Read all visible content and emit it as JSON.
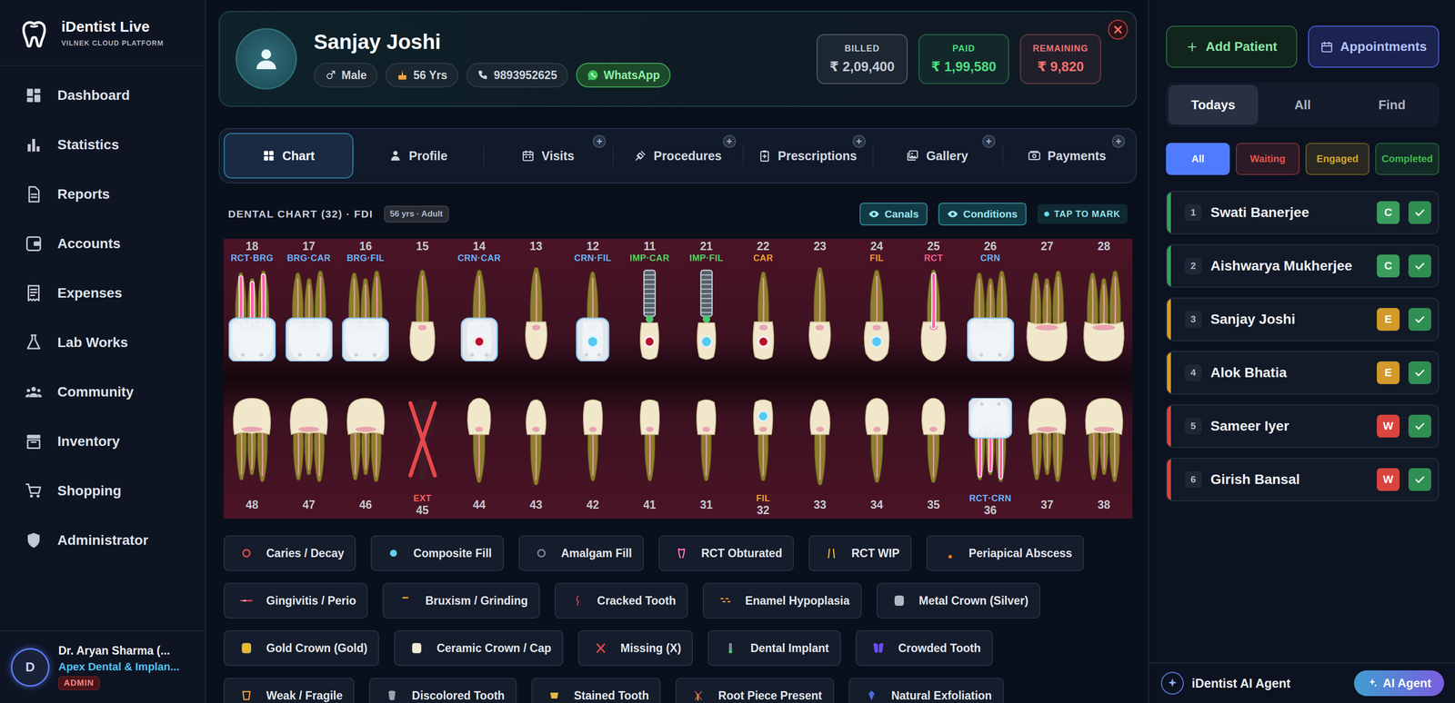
{
  "app": {
    "name": "iDentist Live",
    "subtitle": "VILNEK CLOUD PLATFORM"
  },
  "sidebar": {
    "items": [
      {
        "label": "Dashboard"
      },
      {
        "label": "Statistics"
      },
      {
        "label": "Reports"
      },
      {
        "label": "Accounts"
      },
      {
        "label": "Expenses"
      },
      {
        "label": "Lab Works"
      },
      {
        "label": "Community"
      },
      {
        "label": "Inventory"
      },
      {
        "label": "Shopping"
      },
      {
        "label": "Administrator"
      }
    ]
  },
  "user": {
    "avatar": "D",
    "name": "Dr. Aryan Sharma (...",
    "clinic": "Apex Dental & Implan...",
    "role": "ADMIN"
  },
  "patient": {
    "name": "Sanjay Joshi",
    "gender": "Male",
    "age": "56 Yrs",
    "phone": "9893952625",
    "whatsapp": "WhatsApp"
  },
  "billing": [
    {
      "label": "BILLED",
      "value": "₹ 2,09,400",
      "color": "#c3cad4"
    },
    {
      "label": "PAID",
      "value": "₹ 1,99,580",
      "color": "#4ade80"
    },
    {
      "label": "REMAINING",
      "value": "₹ 9,820",
      "color": "#f87171"
    }
  ],
  "tabs": [
    {
      "label": "Chart",
      "selected": true
    },
    {
      "label": "Profile",
      "selected": false
    },
    {
      "label": "Visits",
      "selected": false,
      "badge": "+"
    },
    {
      "label": "Procedures",
      "selected": false,
      "badge": "+"
    },
    {
      "label": "Prescriptions",
      "selected": false,
      "badge": "+"
    },
    {
      "label": "Gallery",
      "selected": false,
      "badge": "+"
    },
    {
      "label": "Payments",
      "selected": false,
      "badge": "+"
    }
  ],
  "chart": {
    "title": "DENTAL CHART (32) · FDI",
    "badge": "56 yrs · Adult",
    "toggles": [
      {
        "label": "Canals",
        "on": true
      },
      {
        "label": "Conditions",
        "on": true
      }
    ],
    "tap": "TAP TO MARK",
    "upper": [
      {
        "number": "18",
        "label": "RCT·BRG",
        "color": "#6cb6ff",
        "kind": "molar",
        "rct": true,
        "cap": true,
        "caries": false,
        "fill": false
      },
      {
        "number": "17",
        "label": "BRG·CAR",
        "color": "#6cb6ff",
        "kind": "molar",
        "rct": false,
        "cap": true,
        "caries": false,
        "fill": false
      },
      {
        "number": "16",
        "label": "BRG·FIL",
        "color": "#6cb6ff",
        "kind": "molar",
        "rct": false,
        "cap": true,
        "caries": false,
        "fill": false
      },
      {
        "number": "15",
        "kind": "premolar",
        "rct": false,
        "cap": false,
        "caries": false,
        "fill": false
      },
      {
        "number": "14",
        "label": "CRN·CAR",
        "color": "#6cb6ff",
        "kind": "premolar",
        "rct": false,
        "cap": true,
        "caries": true,
        "fill": false
      },
      {
        "number": "13",
        "kind": "canine",
        "rct": false,
        "cap": false,
        "caries": false,
        "fill": false
      },
      {
        "number": "12",
        "label": "CRN·FIL",
        "color": "#6cb6ff",
        "kind": "incisor",
        "rct": false,
        "cap": true,
        "caries": false,
        "fill": true
      },
      {
        "number": "11",
        "label": "IMP·CAR",
        "color": "#56d364",
        "kind": "implant",
        "rct": false,
        "cap": false,
        "caries": true,
        "fill": false
      },
      {
        "number": "21",
        "label": "IMP·FIL",
        "color": "#56d364",
        "kind": "implant",
        "rct": false,
        "cap": false,
        "caries": false,
        "fill": true
      },
      {
        "number": "22",
        "label": "CAR",
        "color": "#f0a030",
        "kind": "incisor",
        "rct": false,
        "cap": false,
        "caries": true,
        "fill": false
      },
      {
        "number": "23",
        "kind": "canine",
        "rct": false,
        "cap": false,
        "caries": false,
        "fill": false
      },
      {
        "number": "24",
        "label": "FIL",
        "color": "#f0a030",
        "kind": "premolar",
        "rct": false,
        "cap": false,
        "caries": false,
        "fill": true
      },
      {
        "number": "25",
        "label": "RCT",
        "color": "#ff5d8f",
        "kind": "premolar",
        "rct": true,
        "cap": false,
        "caries": false,
        "fill": false
      },
      {
        "number": "26",
        "label": "CRN",
        "color": "#6cb6ff",
        "kind": "molar",
        "rct": false,
        "cap": true,
        "caries": false,
        "fill": false
      },
      {
        "number": "27",
        "kind": "molar",
        "rct": false,
        "cap": false,
        "caries": false,
        "fill": false
      },
      {
        "number": "28",
        "kind": "molar",
        "rct": false,
        "cap": false,
        "caries": false,
        "fill": false
      }
    ],
    "lower": [
      {
        "number": "48",
        "kind": "molar",
        "rct": false,
        "cap": false,
        "caries": false,
        "fill": false
      },
      {
        "number": "47",
        "kind": "molar",
        "rct": false,
        "cap": false,
        "caries": false,
        "fill": false
      },
      {
        "number": "46",
        "kind": "molar",
        "rct": false,
        "cap": false,
        "caries": false,
        "fill": false
      },
      {
        "number": "45",
        "label": "EXT",
        "color": "#ff5d5d",
        "kind": "missing",
        "rct": false,
        "cap": false,
        "caries": false,
        "fill": false
      },
      {
        "number": "44",
        "kind": "premolar",
        "rct": false,
        "cap": false,
        "caries": false,
        "fill": false
      },
      {
        "number": "43",
        "kind": "canine",
        "rct": false,
        "cap": false,
        "caries": false,
        "fill": false
      },
      {
        "number": "42",
        "kind": "incisor",
        "rct": false,
        "cap": false,
        "caries": false,
        "fill": false
      },
      {
        "number": "41",
        "kind": "incisor",
        "rct": false,
        "cap": false,
        "caries": false,
        "fill": false
      },
      {
        "number": "31",
        "kind": "incisor",
        "rct": false,
        "cap": false,
        "caries": false,
        "fill": false
      },
      {
        "number": "32",
        "label": "FIL",
        "color": "#f0a030",
        "kind": "incisor",
        "rct": false,
        "cap": false,
        "caries": false,
        "fill": true
      },
      {
        "number": "33",
        "kind": "canine",
        "rct": false,
        "cap": false,
        "caries": false,
        "fill": false
      },
      {
        "number": "34",
        "kind": "premolar",
        "rct": false,
        "cap": false,
        "caries": false,
        "fill": false
      },
      {
        "number": "35",
        "kind": "premolar",
        "rct": false,
        "cap": false,
        "caries": false,
        "fill": false
      },
      {
        "number": "36",
        "label": "RCT·CRN",
        "color": "#6cb6ff",
        "kind": "molar",
        "rct": true,
        "cap": true,
        "caries": false,
        "fill": false
      },
      {
        "number": "37",
        "kind": "molar",
        "rct": false,
        "cap": false,
        "caries": false,
        "fill": false
      },
      {
        "number": "38",
        "kind": "molar",
        "rct": false,
        "cap": false,
        "caries": false,
        "fill": false
      }
    ]
  },
  "legend": [
    {
      "label": "Caries / Decay",
      "kind": "caries"
    },
    {
      "label": "Composite Fill",
      "kind": "composite"
    },
    {
      "label": "Amalgam Fill",
      "kind": "amalgam"
    },
    {
      "label": "RCT Obturated",
      "kind": "rct"
    },
    {
      "label": "RCT WIP",
      "kind": "rctwip"
    },
    {
      "label": "Periapical Abscess",
      "kind": "abscess"
    },
    {
      "label": "Gingivitis / Perio",
      "kind": "gingivitis"
    },
    {
      "label": "Bruxism / Grinding",
      "kind": "bruxism"
    },
    {
      "label": "Cracked Tooth",
      "kind": "cracked"
    },
    {
      "label": "Enamel Hypoplasia",
      "kind": "hypoplasia"
    },
    {
      "label": "Metal Crown (Silver)",
      "kind": "metalcrown"
    },
    {
      "label": "Gold Crown (Gold)",
      "kind": "goldcrown"
    },
    {
      "label": "Ceramic Crown / Cap",
      "kind": "ceramiccrown"
    },
    {
      "label": "Missing (X)",
      "kind": "missing"
    },
    {
      "label": "Dental Implant",
      "kind": "implant"
    },
    {
      "label": "Crowded Tooth",
      "kind": "crowded"
    },
    {
      "label": "Weak / Fragile",
      "kind": "weak"
    },
    {
      "label": "Discolored Tooth",
      "kind": "discolored"
    },
    {
      "label": "Stained Tooth",
      "kind": "stained"
    },
    {
      "label": "Root Piece Present",
      "kind": "rootpiece"
    },
    {
      "label": "Natural Exfoliation",
      "kind": "exfoliation"
    }
  ],
  "actions": [
    {
      "label": "Add Patient"
    },
    {
      "label": "Appointments"
    }
  ],
  "queue_tabs": [
    {
      "label": "Todays",
      "selected": true
    },
    {
      "label": "All",
      "selected": false
    },
    {
      "label": "Find",
      "selected": false
    }
  ],
  "filters": [
    {
      "label": "All",
      "selected": true,
      "color": "#4f7cff"
    },
    {
      "label": "Waiting",
      "selected": false,
      "color": "#e5534b"
    },
    {
      "label": "Engaged",
      "selected": false,
      "color": "#d4a72c"
    },
    {
      "label": "Completed",
      "selected": false,
      "color": "#3fb950"
    }
  ],
  "queue": [
    {
      "index": "1",
      "name": "Swati Banerjee",
      "status": "C",
      "color": "#3a9d5d"
    },
    {
      "index": "2",
      "name": "Aishwarya Mukherjee",
      "status": "C",
      "color": "#3a9d5d"
    },
    {
      "index": "3",
      "name": "Sanjay Joshi",
      "status": "E",
      "color": "#d19a2a"
    },
    {
      "index": "4",
      "name": "Alok Bhatia",
      "status": "E",
      "color": "#d19a2a"
    },
    {
      "index": "5",
      "name": "Sameer Iyer",
      "status": "W",
      "color": "#d9443e"
    },
    {
      "index": "6",
      "name": "Girish Bansal",
      "status": "W",
      "color": "#d9443e"
    }
  ],
  "ai": {
    "title": "iDentist AI Agent",
    "button": "AI Agent"
  }
}
